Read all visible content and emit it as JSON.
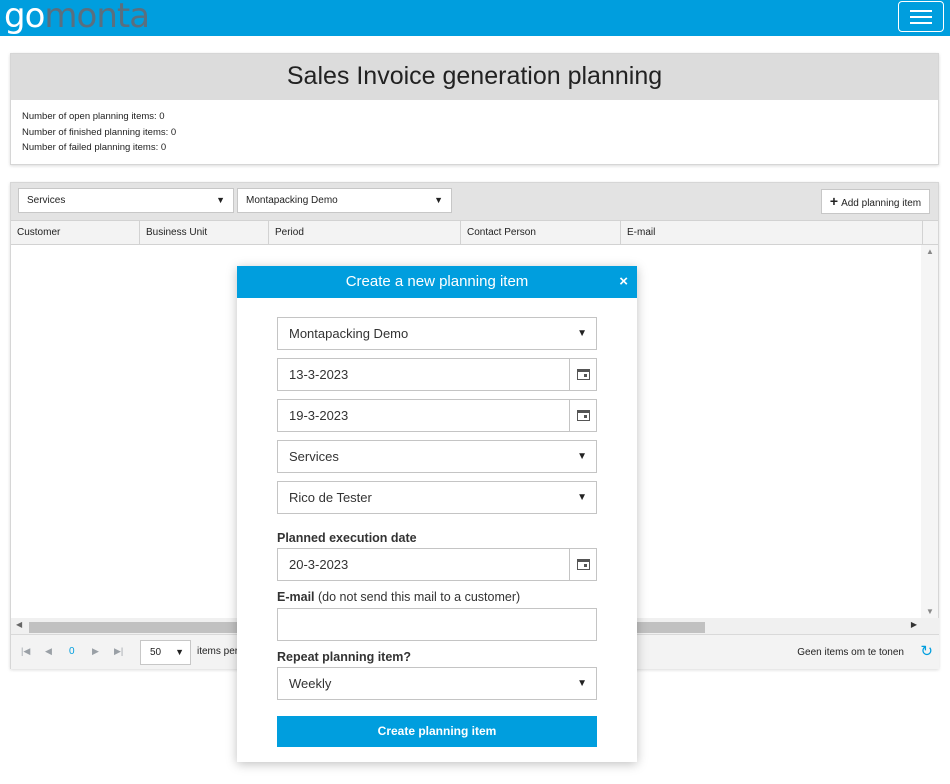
{
  "brand": {
    "logo_part1": "go",
    "logo_part2": "monta"
  },
  "summary": {
    "title": "Sales Invoice generation planning",
    "lines": [
      "Number of open planning items: 0",
      "Number of finished planning items: 0",
      "Number of failed planning items: 0"
    ]
  },
  "toolbar": {
    "filter_type": "Services",
    "filter_business_unit": "Montapacking Demo",
    "add_label": "Add planning item"
  },
  "grid": {
    "columns": [
      "Customer",
      "Business Unit",
      "Period",
      "Contact Person",
      "E-mail"
    ],
    "pager": {
      "current_page": "0",
      "page_size": "50",
      "per_page_label": "items per page",
      "empty_text": "Geen items om te tonen"
    }
  },
  "modal": {
    "title": "Create a new planning item",
    "close": "×",
    "business_unit": "Montapacking Demo",
    "period_start": "13-3-2023",
    "period_end": "19-3-2023",
    "type": "Services",
    "contact_person": "Rico de Tester",
    "execution_label": "Planned execution date",
    "execution_date": "20-3-2023",
    "email_label": "E-mail",
    "email_note": "(do not send this mail to a customer)",
    "email_value": "",
    "repeat_label": "Repeat planning item?",
    "repeat_value": "Weekly",
    "submit_label": "Create planning item"
  },
  "colors": {
    "accent": "#009ede",
    "logo_secondary": "#5a6f7f"
  }
}
